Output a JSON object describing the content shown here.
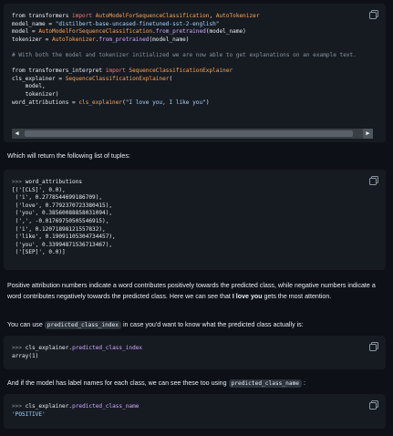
{
  "code1": {
    "lines": [
      [
        {
          "t": "from transformers ",
          "c": ""
        },
        {
          "t": "import ",
          "c": "kw"
        },
        {
          "t": "AutoModelForSequenceClassification",
          "c": "var"
        },
        {
          "t": ", ",
          "c": ""
        },
        {
          "t": "AutoTokenizer",
          "c": "var"
        }
      ],
      [
        {
          "t": "model_name = ",
          "c": ""
        },
        {
          "t": "\"distilbert-base-uncased-finetuned-sst-2-english\"",
          "c": "str"
        }
      ],
      [
        {
          "t": "model = ",
          "c": ""
        },
        {
          "t": "AutoModelForSequenceClassification",
          "c": "var"
        },
        {
          "t": ".",
          "c": ""
        },
        {
          "t": "from_pretrained",
          "c": "fn"
        },
        {
          "t": "(model_name)",
          "c": ""
        }
      ],
      [
        {
          "t": "tokenizer = ",
          "c": ""
        },
        {
          "t": "AutoTokenizer",
          "c": "var"
        },
        {
          "t": ".",
          "c": ""
        },
        {
          "t": "from_pretrained",
          "c": "fn"
        },
        {
          "t": "(model_name)",
          "c": ""
        }
      ],
      [
        {
          "t": "",
          "c": ""
        }
      ],
      [
        {
          "t": "# With both the model and tokenizer initialized we are now able to get explanations on an example text.",
          "c": "cm"
        }
      ],
      [
        {
          "t": "",
          "c": ""
        }
      ],
      [
        {
          "t": "from transformers_interpret ",
          "c": ""
        },
        {
          "t": "import ",
          "c": "kw"
        },
        {
          "t": "SequenceClassificationExplainer",
          "c": "var"
        }
      ],
      [
        {
          "t": "cls_explainer = ",
          "c": ""
        },
        {
          "t": "SequenceClassificationExplainer",
          "c": "var"
        },
        {
          "t": "(",
          "c": ""
        }
      ],
      [
        {
          "t": "    model,",
          "c": ""
        }
      ],
      [
        {
          "t": "    tokenizer)",
          "c": ""
        }
      ],
      [
        {
          "t": "word_attributions = ",
          "c": ""
        },
        {
          "t": "cls_explainer",
          "c": "var"
        },
        {
          "t": "(",
          "c": ""
        },
        {
          "t": "\"I love you, I like you\"",
          "c": "str"
        },
        {
          "t": ")",
          "c": ""
        }
      ]
    ]
  },
  "para1": "Which will return the following list of tuples:",
  "code2": {
    "lines": [
      [
        {
          "t": ">>> ",
          "c": "prompt"
        },
        {
          "t": "word_attributions",
          "c": ""
        }
      ],
      [
        {
          "t": "[('[CLS]', 0.0),",
          "c": ""
        }
      ],
      [
        {
          "t": " ('i', 0.2778544699186709),",
          "c": ""
        }
      ],
      [
        {
          "t": " ('love', 0.7792370723380415),",
          "c": ""
        }
      ],
      [
        {
          "t": " ('you', 0.38560088858031094),",
          "c": ""
        }
      ],
      [
        {
          "t": " (',', -0.01769750505546915),",
          "c": ""
        }
      ],
      [
        {
          "t": " ('i', 0.12071898121557832),",
          "c": ""
        }
      ],
      [
        {
          "t": " ('like', 0.19091105304734457),",
          "c": ""
        }
      ],
      [
        {
          "t": " ('you', 0.33994871536713467),",
          "c": ""
        }
      ],
      [
        {
          "t": " ('[SEP]', 0.0)]",
          "c": ""
        }
      ]
    ]
  },
  "para2": {
    "before": "Positive attribution numbers indicate a word contributes positively towards the predicted class, while negative numbers indicate a word contributes negatively towards the predicted class. Here we can see that ",
    "bold": "I love you",
    "after": " gets the most attention."
  },
  "para3": {
    "before": "You can use ",
    "code": "predicted_class_index",
    "after": " in case you'd want to know what the predicted class actually is:"
  },
  "code3": {
    "lines": [
      [
        {
          "t": ">>> ",
          "c": "prompt"
        },
        {
          "t": "cls_explainer",
          "c": ""
        },
        {
          "t": ".",
          "c": ""
        },
        {
          "t": "predicted_class_index",
          "c": "fn"
        }
      ],
      [
        {
          "t": "array(1)",
          "c": ""
        }
      ]
    ]
  },
  "para4": {
    "before": "And if the model has label names for each class, we can see these too using ",
    "code": "predicted_class_name",
    "after": " :"
  },
  "code4": {
    "lines": [
      [
        {
          "t": ">>> ",
          "c": "prompt"
        },
        {
          "t": "cls_explainer",
          "c": ""
        },
        {
          "t": ".",
          "c": ""
        },
        {
          "t": "predicted_class_name",
          "c": "fn"
        }
      ],
      [
        {
          "t": "'POSITIVE'",
          "c": "str"
        }
      ]
    ]
  },
  "icons": {
    "copy": "copy-icon",
    "scroll_left": "scroll-left-arrow-icon",
    "scroll_right": "scroll-right-arrow-icon"
  },
  "colors": {
    "background": "#0d1117",
    "code_background": "#161b22",
    "keyword": "#ff7b72",
    "string": "#a5d6ff",
    "function": "#d2a8ff",
    "class_name": "#ffa657",
    "comment": "#8b949e"
  }
}
